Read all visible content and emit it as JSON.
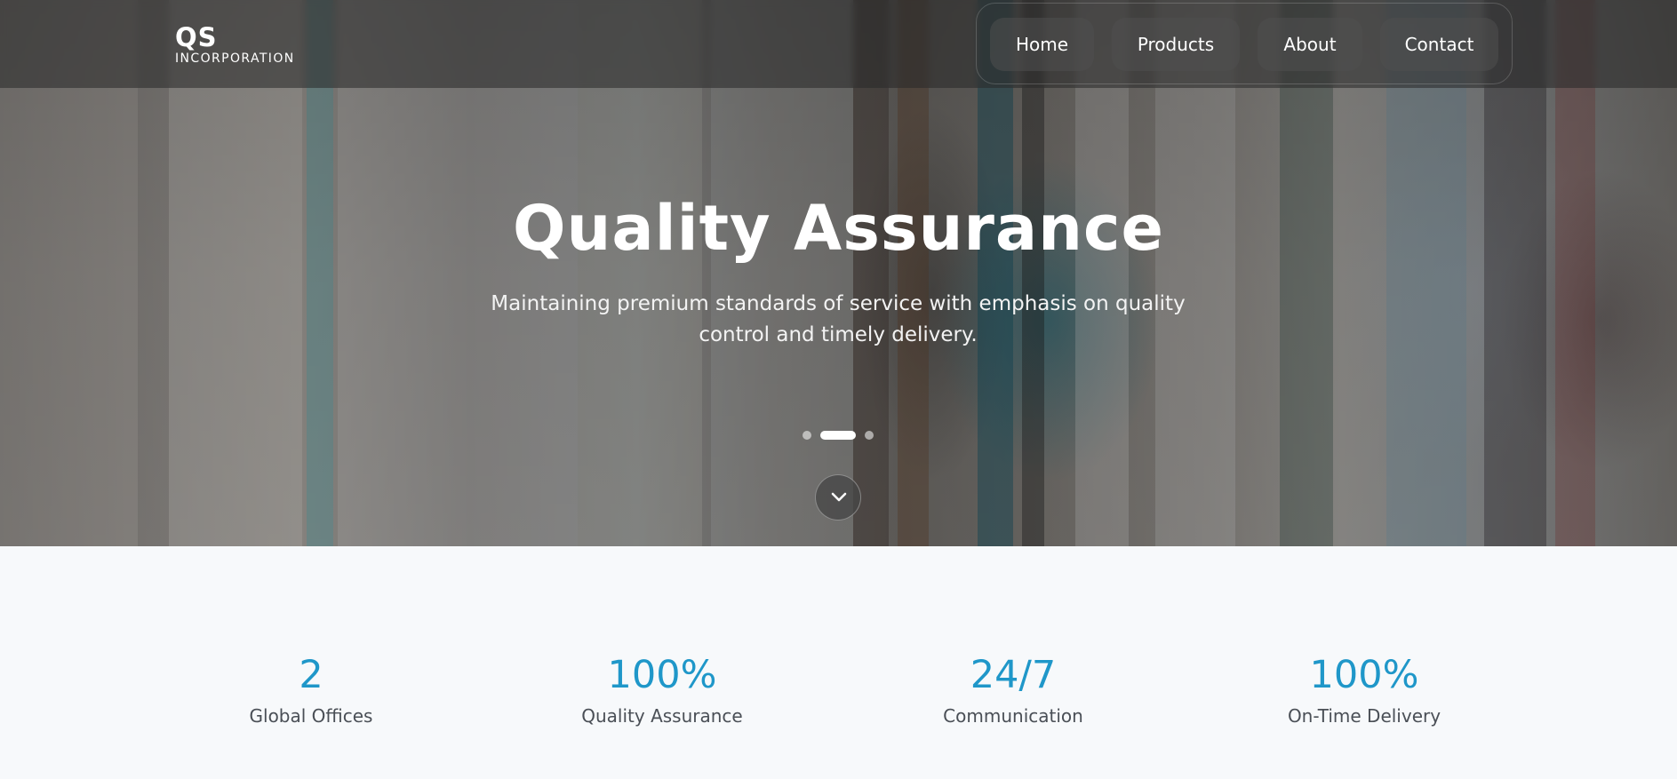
{
  "brand": {
    "logo_mark": "QS",
    "logo_sub": "INCORPORATION"
  },
  "nav": {
    "items": [
      {
        "label": "Home"
      },
      {
        "label": "Products"
      },
      {
        "label": "About"
      },
      {
        "label": "Contact"
      }
    ]
  },
  "hero": {
    "title": "Quality Assurance",
    "subtitle": "Maintaining premium standards of service with emphasis on quality control and timely delivery.",
    "slide_indicators": {
      "count": 3,
      "active_index": 1
    },
    "scroll_icon": "chevron-down-icon"
  },
  "stats": [
    {
      "value": "2",
      "label": "Global Offices"
    },
    {
      "value": "100%",
      "label": "Quality Assurance"
    },
    {
      "value": "24/7",
      "label": "Communication"
    },
    {
      "value": "100%",
      "label": "On-Time Delivery"
    }
  ],
  "colors": {
    "accent": "#1f97c9",
    "stat_label": "#4a4f56",
    "stats_background": "#f7f9fb"
  }
}
